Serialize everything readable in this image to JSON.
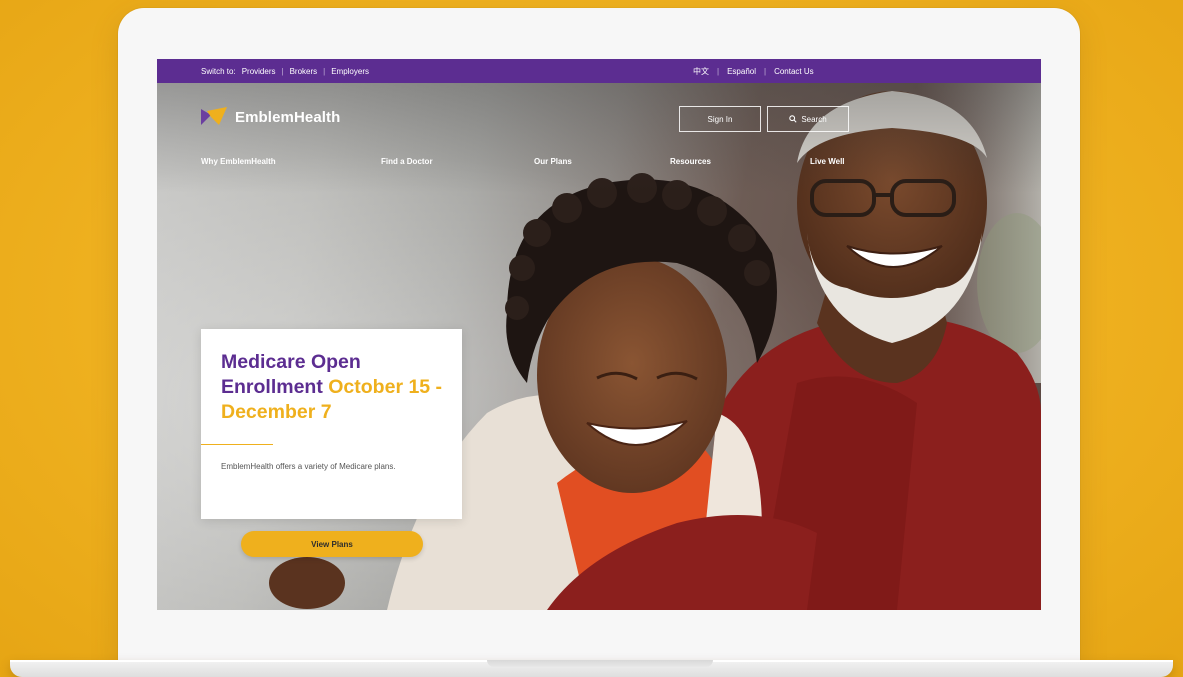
{
  "utility_bar": {
    "switch_label": "Switch to:",
    "links": [
      "Providers",
      "Brokers",
      "Employers"
    ],
    "language_links": [
      "中文",
      "Español"
    ],
    "contact_label": "Contact Us"
  },
  "header": {
    "logo_text": "EmblemHealth",
    "sign_in_label": "Sign In",
    "search_label": "Search"
  },
  "nav": {
    "items": [
      "Why EmblemHealth",
      "Find a Doctor",
      "Our Plans",
      "Resources",
      "Live Well"
    ]
  },
  "promo": {
    "title_part1": "Medicare Open Enrollment",
    "title_part2": "October 15 - December 7",
    "body": "EmblemHealth offers a variety of Medicare plans.",
    "cta_label": "View Plans"
  },
  "colors": {
    "brand_purple": "#5c2d91",
    "brand_gold": "#efb01d",
    "background_yellow": "#f0b322"
  },
  "icons": {
    "logo": "emblem-logo-icon",
    "search": "search-icon"
  }
}
